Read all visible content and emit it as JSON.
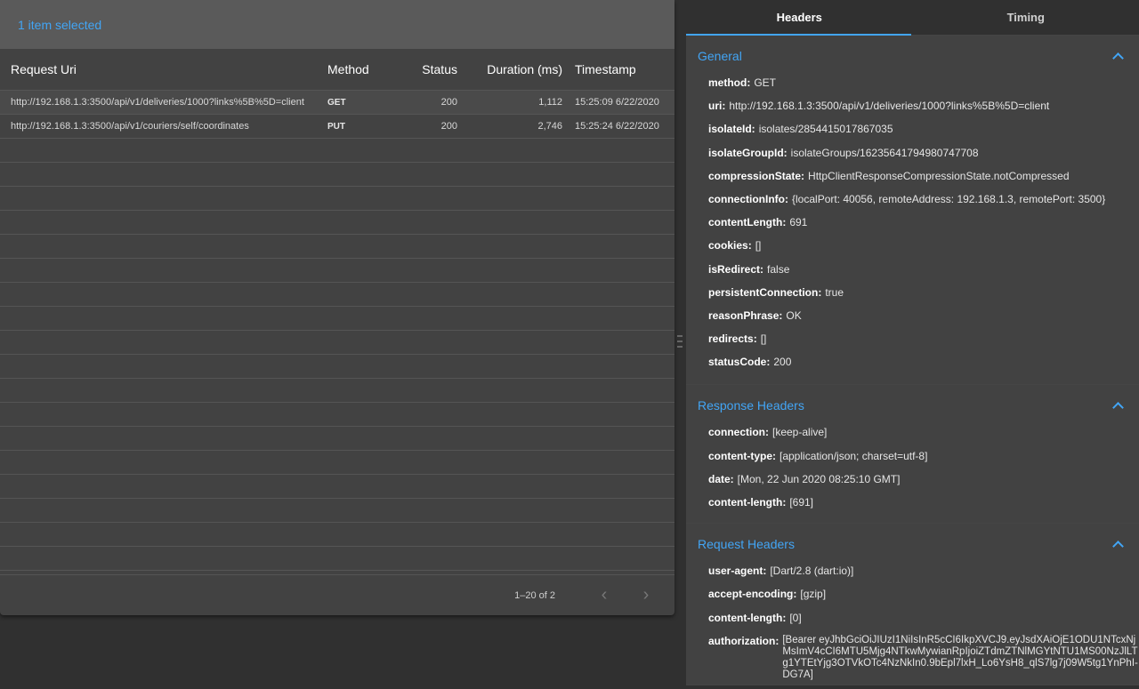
{
  "selection_text": "1 item selected",
  "columns": {
    "uri": "Request Uri",
    "method": "Method",
    "status": "Status",
    "duration": "Duration (ms)",
    "timestamp": "Timestamp"
  },
  "rows": [
    {
      "uri": "http://192.168.1.3:3500/api/v1/deliveries/1000?links%5B%5D=client",
      "method": "GET",
      "status": "200",
      "duration": "1,112",
      "timestamp": "15:25:09 6/22/2020"
    },
    {
      "uri": "http://192.168.1.3:3500/api/v1/couriers/self/coordinates",
      "method": "PUT",
      "status": "200",
      "duration": "2,746",
      "timestamp": "15:25:24 6/22/2020"
    }
  ],
  "pager": {
    "range": "1–20 of 2"
  },
  "tabs": {
    "headers": "Headers",
    "timing": "Timing"
  },
  "general": {
    "title": "General",
    "items": [
      {
        "k": "method:",
        "v": "GET"
      },
      {
        "k": "uri:",
        "v": "http://192.168.1.3:3500/api/v1/deliveries/1000?links%5B%5D=client"
      },
      {
        "k": "isolateId:",
        "v": "isolates/2854415017867035"
      },
      {
        "k": "isolateGroupId:",
        "v": "isolateGroups/16235641794980747708"
      },
      {
        "k": "compressionState:",
        "v": "HttpClientResponseCompressionState.notCompressed"
      },
      {
        "k": "connectionInfo:",
        "v": "{localPort: 40056, remoteAddress: 192.168.1.3, remotePort: 3500}"
      },
      {
        "k": "contentLength:",
        "v": "691"
      },
      {
        "k": "cookies:",
        "v": "[]"
      },
      {
        "k": "isRedirect:",
        "v": "false"
      },
      {
        "k": "persistentConnection:",
        "v": "true"
      },
      {
        "k": "reasonPhrase:",
        "v": "OK"
      },
      {
        "k": "redirects:",
        "v": "[]"
      },
      {
        "k": "statusCode:",
        "v": "200"
      }
    ]
  },
  "response_headers": {
    "title": "Response Headers",
    "items": [
      {
        "k": "connection:",
        "v": "[keep-alive]"
      },
      {
        "k": "content-type:",
        "v": "[application/json; charset=utf-8]"
      },
      {
        "k": "date:",
        "v": "[Mon, 22 Jun 2020 08:25:10 GMT]"
      },
      {
        "k": "content-length:",
        "v": "[691]"
      }
    ]
  },
  "request_headers": {
    "title": "Request Headers",
    "items": [
      {
        "k": "user-agent:",
        "v": "[Dart/2.8 (dart:io)]"
      },
      {
        "k": "accept-encoding:",
        "v": "[gzip]"
      },
      {
        "k": "content-length:",
        "v": "[0]"
      },
      {
        "k": "authorization:",
        "v": "[Bearer eyJhbGciOiJIUzI1NiIsInR5cCI6IkpXVCJ9.eyJsdXAiOjE1ODU1NTcxNjMsImV4cCI6MTU5Mjg4NTkwMywianRpIjoiZTdmZTNlMGYtNTU1MS00NzJlLTg1YTEtYjg3OTVkOTc4NzNkIn0.9bEpl7lxH_Lo6YsH8_qlS7lg7j09W5tg1YnPhI-DG7A]"
      }
    ]
  }
}
